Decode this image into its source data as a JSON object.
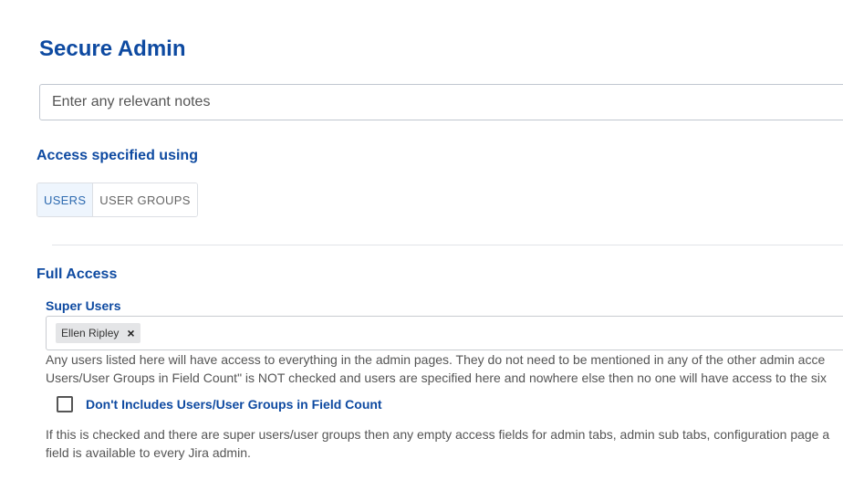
{
  "page": {
    "title": "Secure Admin"
  },
  "notes": {
    "placeholder": "Enter any relevant notes",
    "value": ""
  },
  "access": {
    "heading": "Access specified using",
    "options": [
      "USERS",
      "USER GROUPS"
    ],
    "selected": "USERS"
  },
  "full_access": {
    "heading": "Full Access",
    "super_users": {
      "label": "Super Users",
      "selected": [
        "Ellen Ripley"
      ],
      "remove_glyph": "×",
      "help_line_1": "Any users listed here will have access to everything in the admin pages. They do not need to be mentioned in any of the other admin acce",
      "help_line_2": "Users/User Groups in Field Count\" is NOT checked and users are specified here and nowhere else then no one will have access to the six"
    },
    "field_count_checkbox": {
      "label": "Don't Includes Users/User Groups in Field Count",
      "checked": false
    },
    "checkbox_help_line_1": "If this is checked and there are super users/user groups then any empty access fields for admin tabs, admin sub tabs, configuration page a",
    "checkbox_help_line_2": "field is available to every Jira admin."
  },
  "colors": {
    "heading_blue": "#0e4aa1",
    "active_tab_bg": "#eef5fd",
    "active_tab_text": "#2d6ab0",
    "chip_bg": "#e4e5e7"
  }
}
